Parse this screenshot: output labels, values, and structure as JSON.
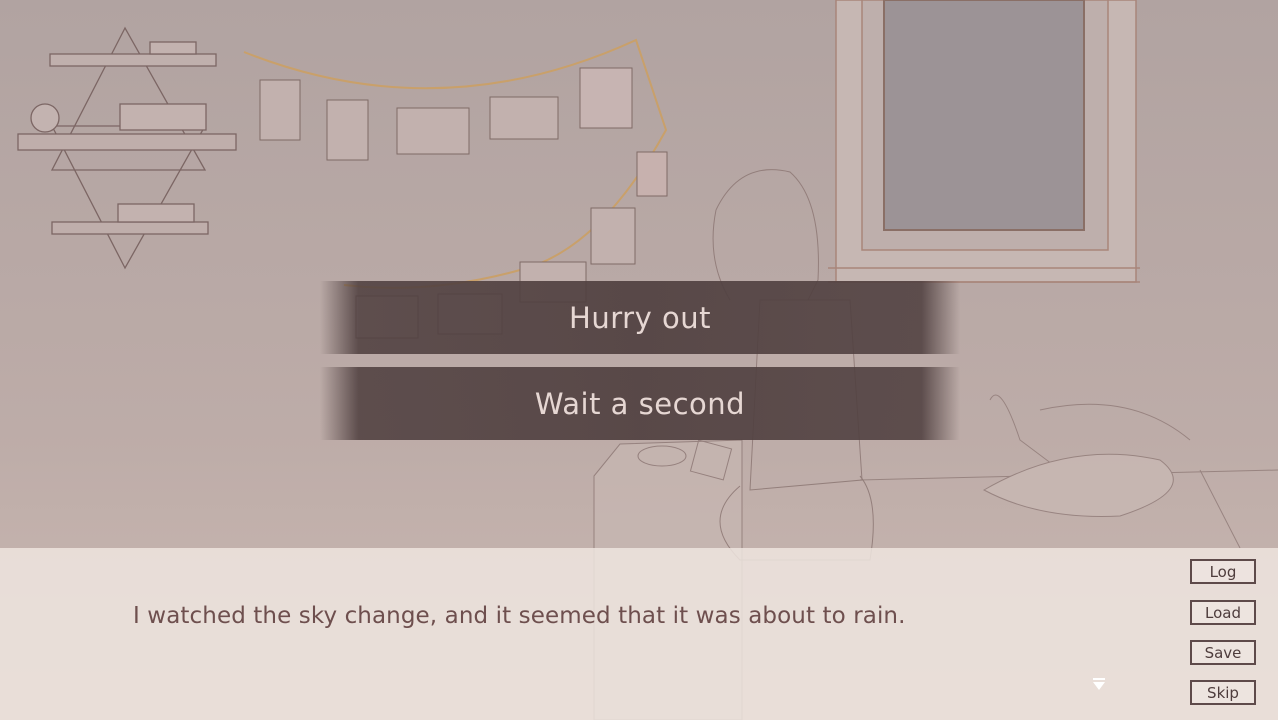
{
  "choices": [
    {
      "label": "Hurry out"
    },
    {
      "label": "Wait a second"
    }
  ],
  "dialogue": {
    "text": "I watched the sky change, and it seemed that it was about to rain."
  },
  "menu": {
    "log": "Log",
    "load": "Load",
    "save": "Save",
    "skip": "Skip"
  },
  "icons": {
    "advance": "triangle-down-icon"
  },
  "colors": {
    "choice_bg": "#504040",
    "choice_text": "#e6d7d3",
    "dialogue_text": "#6e4f4e",
    "textbox_bg": "#eee4de",
    "button_border": "#5e4a4a"
  }
}
